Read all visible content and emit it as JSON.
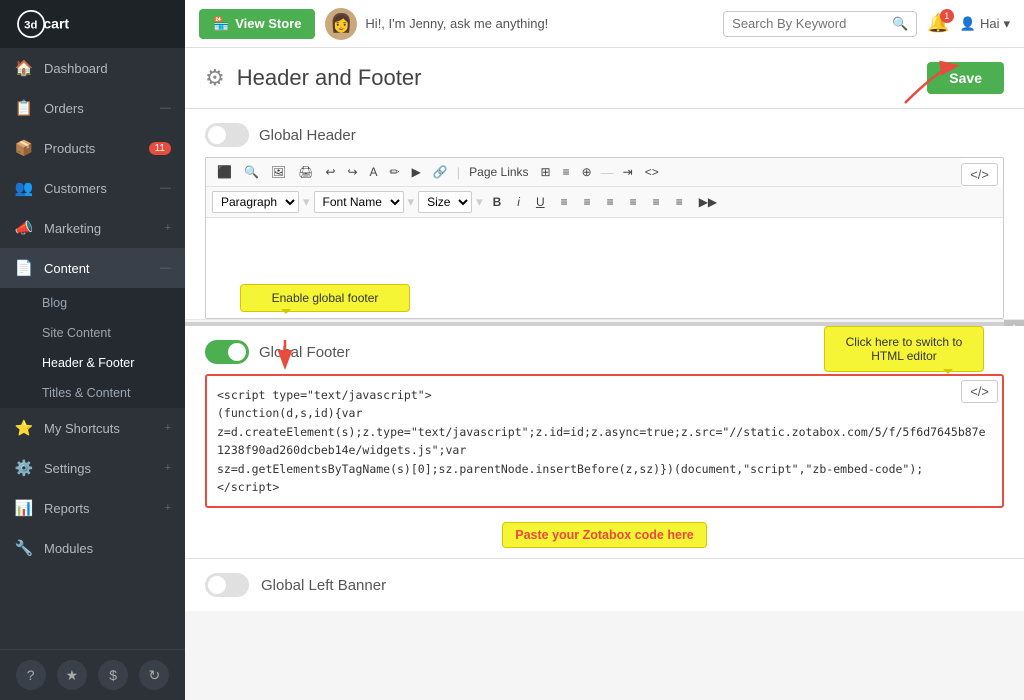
{
  "sidebar": {
    "logo_text": "3dcart",
    "nav_items": [
      {
        "id": "dashboard",
        "label": "Dashboard",
        "icon": "🏠",
        "badge": null,
        "expanded": false
      },
      {
        "id": "orders",
        "label": "Orders",
        "icon": "📋",
        "badge": null,
        "expanded": false
      },
      {
        "id": "products",
        "label": "Products",
        "icon": "📦",
        "badge": "11",
        "expanded": false
      },
      {
        "id": "customers",
        "label": "Customers",
        "icon": "👥",
        "badge": null,
        "expanded": false
      },
      {
        "id": "marketing",
        "label": "Marketing",
        "icon": "📣",
        "badge": null,
        "expanded": false
      },
      {
        "id": "content",
        "label": "Content",
        "icon": "📄",
        "badge": null,
        "expanded": true
      },
      {
        "id": "my-shortcuts",
        "label": "My Shortcuts",
        "icon": "⭐",
        "badge": null,
        "expanded": false
      },
      {
        "id": "settings",
        "label": "Settings",
        "icon": "⚙️",
        "badge": null,
        "expanded": false
      },
      {
        "id": "reports",
        "label": "Reports",
        "icon": "📊",
        "badge": null,
        "expanded": false
      },
      {
        "id": "modules",
        "label": "Modules",
        "icon": "🔧",
        "badge": null,
        "expanded": false
      }
    ],
    "content_sub_items": [
      {
        "id": "blog",
        "label": "Blog"
      },
      {
        "id": "site-content",
        "label": "Site Content"
      },
      {
        "id": "header-footer",
        "label": "Header & Footer"
      },
      {
        "id": "titles-content",
        "label": "Titles & Content"
      }
    ],
    "bottom_icons": [
      "?",
      "★",
      "$"
    ]
  },
  "topbar": {
    "view_store_label": "View Store",
    "jenny_text": "Hi!, I'm Jenny, ask me anything!",
    "search_placeholder": "Search By Keyword",
    "notification_count": "1",
    "user_name": "Hai"
  },
  "page": {
    "title": "Header and Footer",
    "save_button": "Save",
    "global_header_label": "Global Header",
    "global_footer_label": "Global Footer",
    "global_left_banner_label": "Global Left Banner",
    "footer_toggle_on": true,
    "header_toggle_on": false,
    "code_icon": "</>",
    "editor_toolbar": {
      "paragraph_label": "Paragraph",
      "font_name_label": "Font Name",
      "size_label": "Size"
    },
    "footer_code": "<script type=\"text/javascript\">\n(function(d,s,id){var\nz=d.createElement(s);z.type=\"text/javascript\";z.id=id;z.async=true;z.src=\"//static.zotabox.com/5/f/5f6d7645b87e1238f90ad260dcbeb14e/widgets.js\";var\nsz=d.getElementsByTagName(s)[0];sz.parentNode.insertBefore(z,sz)})(document,\"script\",\"zb-embed-code\");\n</script>",
    "tooltip_enable_footer": "Enable global footer",
    "tooltip_html_editor": "Click here to switch to\nHTML editor",
    "tooltip_paste_zotabox": "Paste your Zotabox code here"
  }
}
